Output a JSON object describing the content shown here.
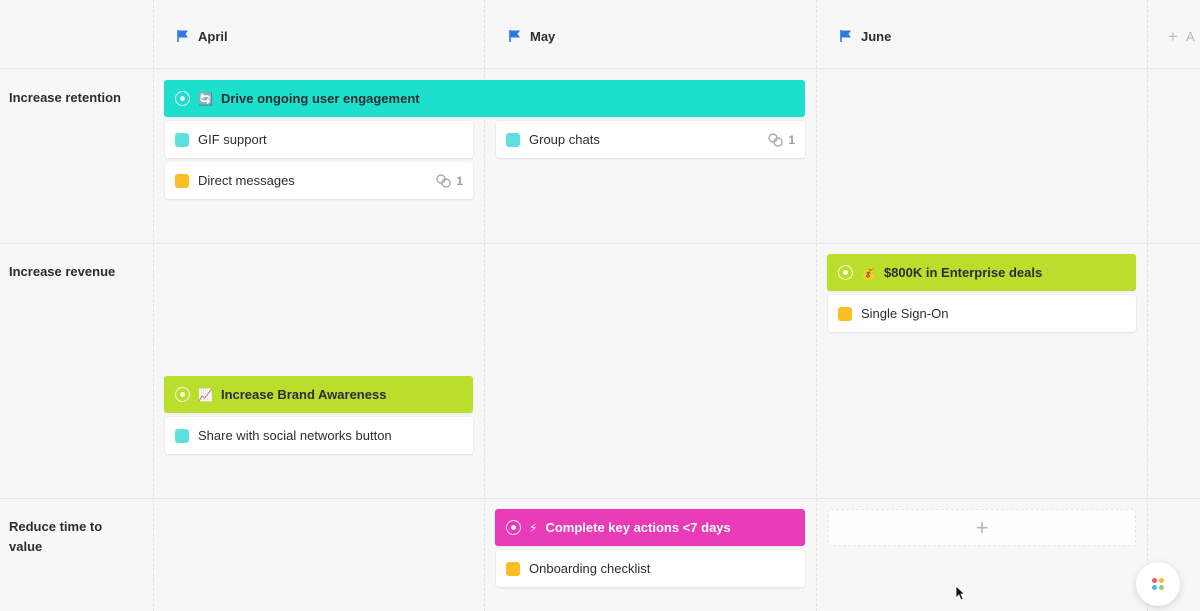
{
  "months": [
    {
      "label": "April"
    },
    {
      "label": "May"
    },
    {
      "label": "June"
    }
  ],
  "add_month_label": "A",
  "rows": [
    {
      "label": "Increase retention"
    },
    {
      "label": "Increase revenue"
    },
    {
      "label": "Reduce time to value"
    }
  ],
  "goals": {
    "engagement": {
      "emoji": "🔄",
      "title": "Drive ongoing user engagement",
      "color": "#1de0cc"
    },
    "enterprise": {
      "emoji": "💰",
      "title": "$800K in Enterprise deals",
      "color": "#b9de2c"
    },
    "brand": {
      "emoji": "📈",
      "title": "Increase Brand Awareness",
      "color": "#b9de2c"
    },
    "actions": {
      "emoji": "⚡",
      "title": "Complete key actions <7 days",
      "color": "#e93ab7"
    }
  },
  "tasks": {
    "gif": {
      "label": "GIF support",
      "status_color": "#5ee0e0"
    },
    "dm": {
      "label": "Direct messages",
      "status_color": "#fbbf24",
      "subtasks": "1"
    },
    "group": {
      "label": "Group chats",
      "status_color": "#5ee0e0",
      "subtasks": "1"
    },
    "sso": {
      "label": "Single Sign-On",
      "status_color": "#fbbf24"
    },
    "share": {
      "label": "Share with social networks button",
      "status_color": "#5ee0e0"
    },
    "onboarding": {
      "label": "Onboarding checklist",
      "status_color": "#fbbf24"
    }
  },
  "colors": {
    "flag": "#2c7be5",
    "apps_dots": [
      "#f0546a",
      "#f8b93c",
      "#4fb3f6",
      "#8bd46c"
    ]
  },
  "icons": {
    "month_flag": "flag-icon",
    "goal": "target-icon",
    "subtasks": "subtasks-icon",
    "add": "plus-icon",
    "apps": "apps-grid-icon",
    "cursor": "mouse-cursor-icon"
  }
}
